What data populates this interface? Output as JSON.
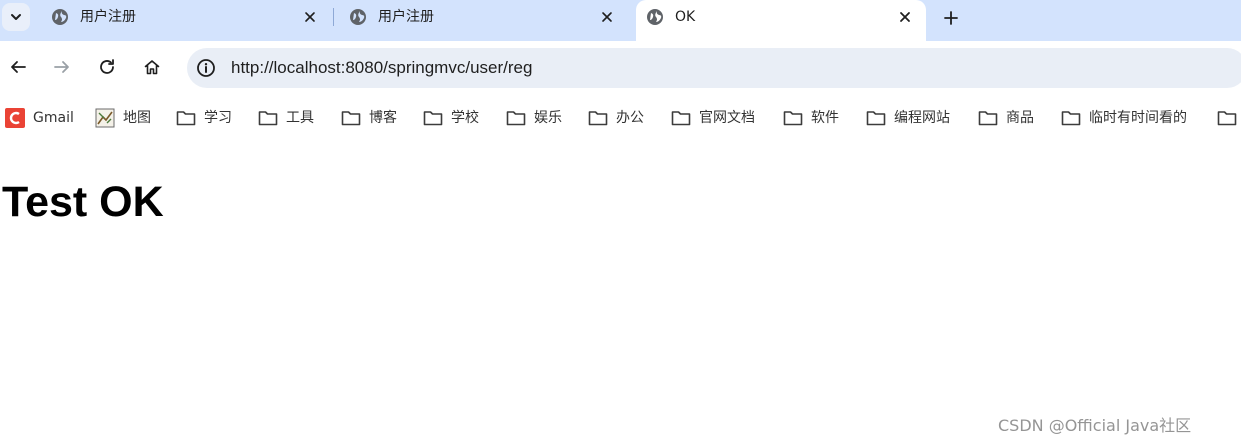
{
  "tabs": [
    {
      "title": "用户注册",
      "active": false
    },
    {
      "title": "用户注册",
      "active": false
    },
    {
      "title": "OK",
      "active": true
    }
  ],
  "toolbar": {
    "url": "http://localhost:8080/springmvc/user/reg"
  },
  "bookmarks": [
    {
      "label": "Gmail",
      "icon": "gmail-icon"
    },
    {
      "label": "地图",
      "icon": "maps-icon"
    },
    {
      "label": "学习",
      "icon": "folder-icon"
    },
    {
      "label": "工具",
      "icon": "folder-icon"
    },
    {
      "label": "博客",
      "icon": "folder-icon"
    },
    {
      "label": "学校",
      "icon": "folder-icon"
    },
    {
      "label": "娱乐",
      "icon": "folder-icon"
    },
    {
      "label": "办公",
      "icon": "folder-icon"
    },
    {
      "label": "官网文档",
      "icon": "folder-icon"
    },
    {
      "label": "软件",
      "icon": "folder-icon"
    },
    {
      "label": "编程网站",
      "icon": "folder-icon"
    },
    {
      "label": "商品",
      "icon": "folder-icon"
    },
    {
      "label": "临时有时间看的",
      "icon": "folder-icon"
    }
  ],
  "page": {
    "heading": "Test OK"
  },
  "watermark": "CSDN @Official Java社区",
  "colors": {
    "tabstrip": "#d3e3fd",
    "omnibox": "#e9eef6",
    "gmail": "#ea4335"
  }
}
